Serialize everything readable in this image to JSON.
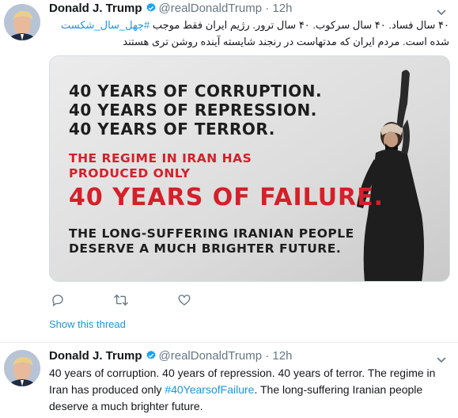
{
  "tweets": [
    {
      "author_name": "Donald J. Trump",
      "handle": "@realDonaldTrump",
      "separator": "·",
      "time": "12h",
      "text_part1": "۴۰ سال فساد. ۴۰ سال سرکوب. ۴۰ سال ترور. رژیم ایران فقط موجب ",
      "hashtag": "#چهل_سال_شکست",
      "text_part2": " شده است. مردم ایران که مدتهاست در رنجند شایسته آینده روشن تری هستند",
      "media": {
        "line1": "40 YEARS OF CORRUPTION.",
        "line2": "40 YEARS OF REPRESSION.",
        "line3": "40 YEARS OF TERROR.",
        "line4": "THE REGIME IN IRAN HAS",
        "line5": "PRODUCED ONLY",
        "line6": "40 YEARS OF FAILURE.",
        "line7": "THE LONG-SUFFERING IRANIAN PEOPLE",
        "line8": "DESERVE A MUCH BRIGHTER FUTURE."
      },
      "show_thread": "Show this thread"
    },
    {
      "author_name": "Donald J. Trump",
      "handle": "@realDonaldTrump",
      "separator": "·",
      "time": "12h",
      "text_part1": "40 years of corruption. 40 years of repression. 40 years of terror. The regime in Iran has produced only ",
      "hashtag": "#40YearsofFailure",
      "text_part2": ". The long-suffering Iranian people deserve a much brighter future."
    }
  ],
  "icons": {
    "verified": "verified-badge-icon",
    "chevron": "chevron-down-icon",
    "reply": "reply-icon",
    "retweet": "retweet-icon",
    "like": "heart-icon"
  },
  "colors": {
    "link": "#1b95e0",
    "verified": "#1da1f2",
    "secondary_text": "#657786",
    "media_red": "#d3202a"
  }
}
